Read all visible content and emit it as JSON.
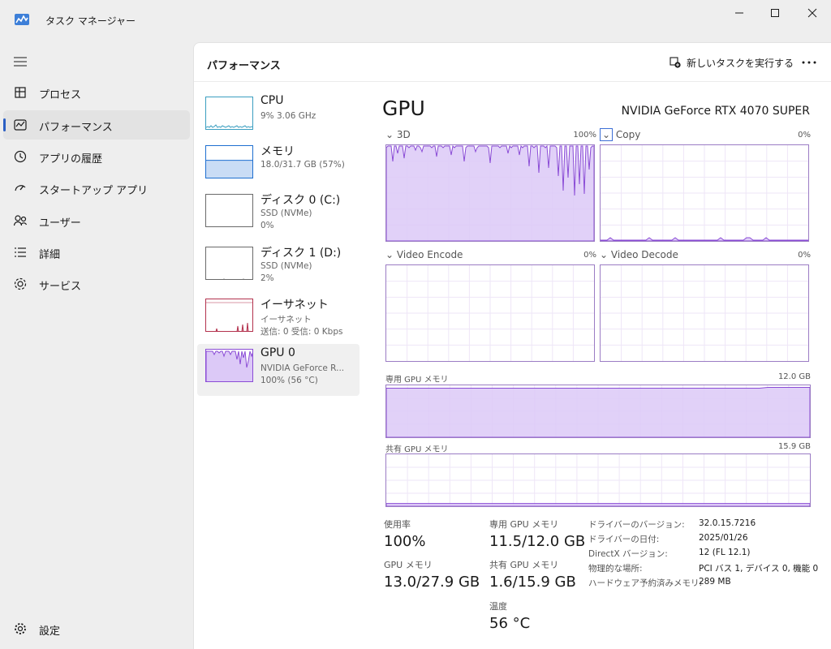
{
  "window": {
    "title": "タスク マネージャー"
  },
  "nav": {
    "items": [
      {
        "label": "プロセス",
        "icon": "processes-icon"
      },
      {
        "label": "パフォーマンス",
        "icon": "performance-icon",
        "active": true
      },
      {
        "label": "アプリの履歴",
        "icon": "history-icon"
      },
      {
        "label": "スタートアップ アプリ",
        "icon": "startup-icon"
      },
      {
        "label": "ユーザー",
        "icon": "users-icon"
      },
      {
        "label": "詳細",
        "icon": "details-icon"
      },
      {
        "label": "サービス",
        "icon": "services-icon"
      }
    ],
    "settings_label": "設定"
  },
  "header": {
    "title": "パフォーマンス",
    "run_task_label": "新しいタスクを実行する"
  },
  "devices": [
    {
      "name": "CPU",
      "line1": "9%  3.06 GHz",
      "utilization": 9
    },
    {
      "name": "メモリ",
      "line1": "18.0/31.7 GB (57%)",
      "utilization": 57
    },
    {
      "name": "ディスク 0 (C:)",
      "line1": "SSD (NVMe)",
      "line2": "0%",
      "utilization": 0
    },
    {
      "name": "ディスク 1 (D:)",
      "line1": "SSD (NVMe)",
      "line2": "2%",
      "utilization": 2
    },
    {
      "name": "イーサネット",
      "line1": "イーサネット",
      "line2": "送信: 0 受信: 0 Kbps"
    },
    {
      "name": "GPU 0",
      "line1": "NVIDIA GeForce R...",
      "line2": "100%  (56 °C)",
      "utilization": 100,
      "selected": true
    }
  ],
  "gpu": {
    "title": "GPU",
    "model": "NVIDIA GeForce RTX 4070 SUPER",
    "engines": [
      {
        "label": "3D",
        "max": "100%",
        "utilization": 100
      },
      {
        "label": "Copy",
        "max": "0%",
        "utilization": 0
      },
      {
        "label": "Video Encode",
        "max": "0%",
        "utilization": 0
      },
      {
        "label": "Video Decode",
        "max": "0%",
        "utilization": 0
      }
    ],
    "dedicated_memory": {
      "label": "専用 GPU メモリ",
      "max": "12.0 GB",
      "used_fraction": 0.96
    },
    "shared_memory": {
      "label": "共有 GPU メモリ",
      "max": "15.9 GB",
      "used_fraction": 0.1
    },
    "stats": {
      "utilization_label": "使用率",
      "utilization_value": "100%",
      "dedicated_label": "専用 GPU メモリ",
      "dedicated_value": "11.5/12.0 GB",
      "gpu_memory_label": "GPU メモリ",
      "gpu_memory_value": "13.0/27.9 GB",
      "shared_label": "共有 GPU メモリ",
      "shared_value": "1.6/15.9 GB",
      "temp_label": "温度",
      "temp_value": "56 °C"
    },
    "info": [
      {
        "key": "ドライバーのバージョン:",
        "value": "32.0.15.7216"
      },
      {
        "key": "ドライバーの日付:",
        "value": "2025/01/26"
      },
      {
        "key": "DirectX バージョン:",
        "value": "12 (FL 12.1)"
      },
      {
        "key": "物理的な場所:",
        "value": "PCI バス 1, デバイス 0, 機能 0"
      },
      {
        "key": "ハードウェア予約済みメモリ:",
        "value": "289 MB"
      }
    ]
  },
  "colors": {
    "gpu_line": "#8a4bd6",
    "gpu_fill": "#dcc9f7",
    "memory_line": "#1e6fd0",
    "memory_fill": "#c9dcf5",
    "ethernet_line": "#b3314d",
    "cpu_line": "#3a9ec0",
    "nav_accent": "#2b5fc4"
  }
}
